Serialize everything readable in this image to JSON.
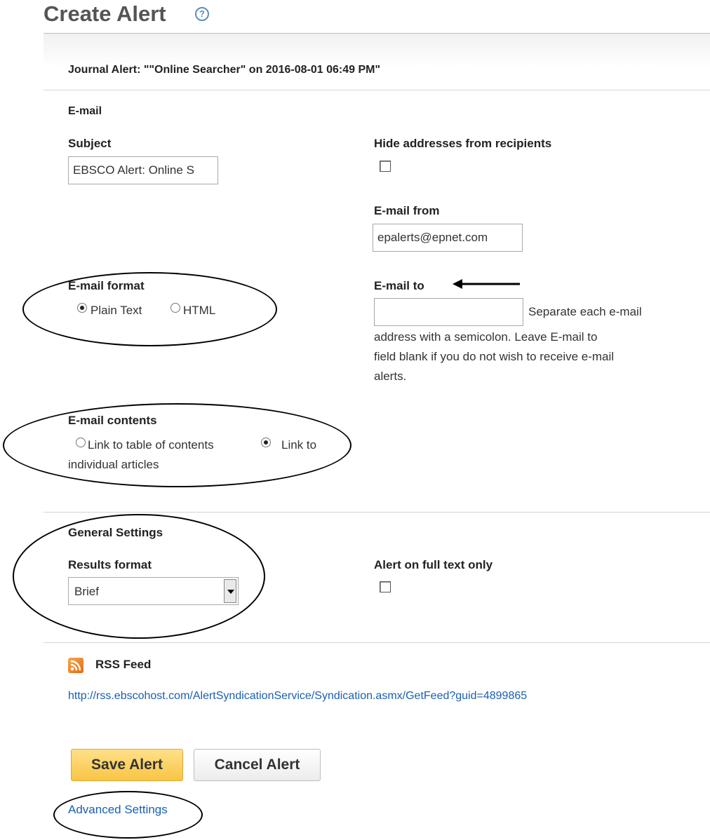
{
  "page": {
    "title": "Create Alert",
    "help_icon": "question-circle-icon",
    "alert_name": "Journal Alert: \"\"Online Searcher\" on 2016-08-01 06:49 PM\""
  },
  "email": {
    "section_title": "E-mail",
    "subject_label": "Subject",
    "subject_value": "EBSCO Alert: Online S",
    "hide_addresses_label": "Hide addresses from recipients",
    "hide_addresses_checked": false,
    "from_label": "E-mail from",
    "from_value": "epalerts@epnet.com",
    "format_label": "E-mail format",
    "format_options": [
      "Plain Text",
      "HTML"
    ],
    "format_selected": "Plain Text",
    "to_label": "E-mail to",
    "to_value": "",
    "to_help_line1": "Separate each e-mail",
    "to_help_line2": "address with a semicolon. Leave E-mail to",
    "to_help_line3": "field blank if you do not wish to receive e-mail",
    "to_help_line4": "alerts.",
    "contents_label": "E-mail contents",
    "contents_option1": "Link to table of contents",
    "contents_option2_line1": "Link to",
    "contents_option2_line2": "individual articles",
    "contents_selected": "Link to individual articles"
  },
  "general": {
    "section_title": "General Settings",
    "results_format_label": "Results format",
    "results_format_value": "Brief",
    "full_text_label": "Alert on full text only",
    "full_text_checked": false
  },
  "rss": {
    "icon": "rss-icon",
    "label": "RSS Feed",
    "url": "http://rss.ebscohost.com/AlertSyndicationService/Syndication.asmx/GetFeed?guid=4899865"
  },
  "actions": {
    "save_label": "Save Alert",
    "cancel_label": "Cancel Alert",
    "advanced_label": "Advanced Settings"
  },
  "colors": {
    "link": "#1a5fb4",
    "save_button": "#f8c544",
    "rss_icon": "#e46c12"
  }
}
